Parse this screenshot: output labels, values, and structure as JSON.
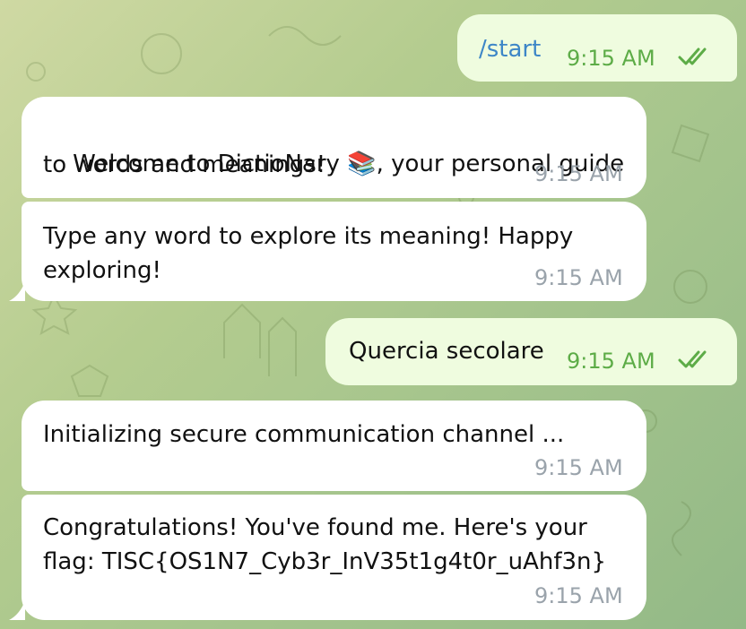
{
  "messages": [
    {
      "id": 1,
      "direction": "out",
      "text": "/start",
      "time": "9:15 AM",
      "status": "read"
    },
    {
      "id": 2,
      "direction": "in",
      "text_before_emoji": "Welcome to DictioNary ",
      "emoji": "📚",
      "text_after_emoji": ", your personal guide",
      "text_line2": "to words and meanings!",
      "time": "9:15 AM"
    },
    {
      "id": 3,
      "direction": "in",
      "text_line1": "Type any word to explore its meaning! Happy",
      "text_line2": "exploring!",
      "time": "9:15 AM"
    },
    {
      "id": 4,
      "direction": "out",
      "text": "Quercia secolare",
      "time": "9:15 AM",
      "status": "read"
    },
    {
      "id": 5,
      "direction": "in",
      "text_line1": "Initializing secure communication channel ...",
      "time": "9:15 AM"
    },
    {
      "id": 6,
      "direction": "in",
      "text_line1": "Congratulations! You've found me. Here's your",
      "text_line2": "flag: TISC{OS1N7_Cyb3r_InV35t1g4t0r_uAhf3n}",
      "time": "9:15 AM"
    }
  ],
  "colors": {
    "incoming_bubble": "#ffffff",
    "outgoing_bubble": "#effcdf",
    "outgoing_time": "#5dac47",
    "incoming_time": "#9aa3ab",
    "command_link": "#3d86c7"
  },
  "icons": {
    "read_status": "double-check-icon",
    "emoji": "books-emoji"
  }
}
